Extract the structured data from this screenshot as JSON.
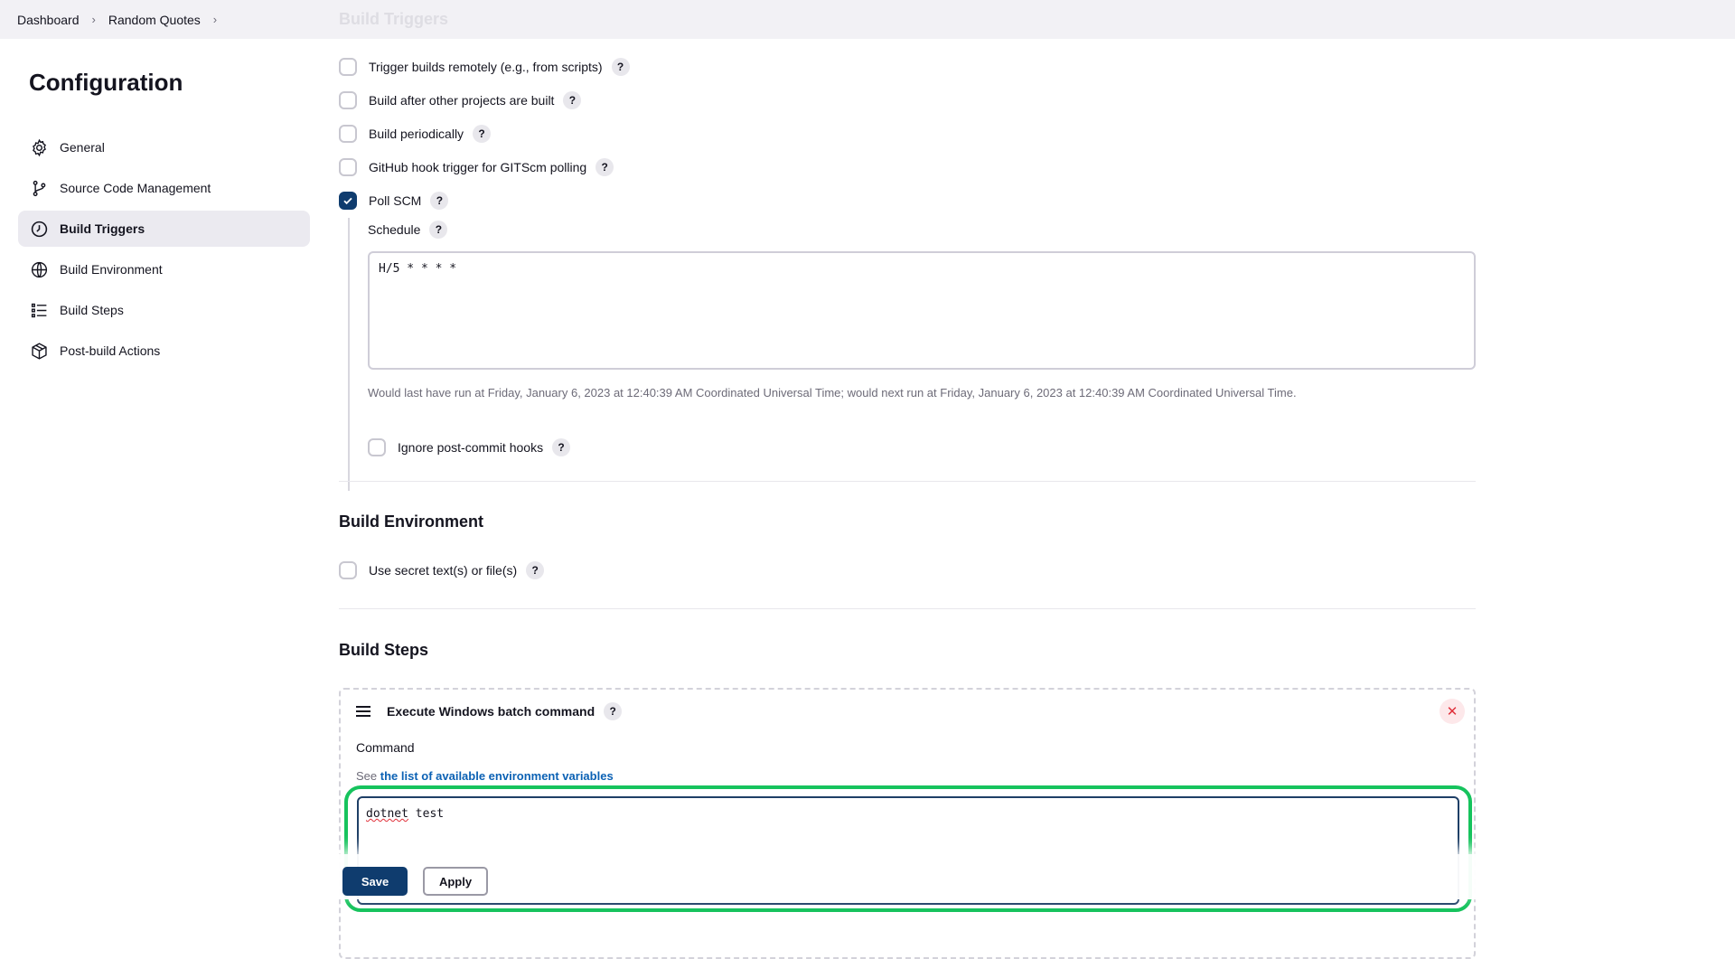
{
  "breadcrumb": {
    "items": [
      "Dashboard",
      "Random Quotes"
    ],
    "faded_section_title": "Build Triggers"
  },
  "sidebar": {
    "title": "Configuration",
    "items": [
      {
        "label": "General",
        "icon": "gear-icon"
      },
      {
        "label": "Source Code Management",
        "icon": "git-branch-icon"
      },
      {
        "label": "Build Triggers",
        "icon": "timer-icon",
        "active": true
      },
      {
        "label": "Build Environment",
        "icon": "globe-icon"
      },
      {
        "label": "Build Steps",
        "icon": "list-icon"
      },
      {
        "label": "Post-build Actions",
        "icon": "cube-icon"
      }
    ]
  },
  "triggers": {
    "remote": {
      "label": "Trigger builds remotely (e.g., from scripts)",
      "checked": false
    },
    "after_other": {
      "label": "Build after other projects are built",
      "checked": false
    },
    "periodically": {
      "label": "Build periodically",
      "checked": false
    },
    "github_hook": {
      "label": "GitHub hook trigger for GITScm polling",
      "checked": false
    },
    "poll_scm": {
      "label": "Poll SCM",
      "checked": true
    },
    "schedule_label": "Schedule",
    "schedule_value": "H/5 * * * *",
    "schedule_hint": "Would last have run at Friday, January 6, 2023 at 12:40:39 AM Coordinated Universal Time; would next run at Friday, January 6, 2023 at 12:40:39 AM Coordinated Universal Time.",
    "ignore_hooks": {
      "label": "Ignore post-commit hooks",
      "checked": false
    }
  },
  "build_environment": {
    "title": "Build Environment",
    "secret": {
      "label": "Use secret text(s) or file(s)",
      "checked": false
    }
  },
  "build_steps": {
    "title": "Build Steps",
    "step": {
      "title": "Execute Windows batch command",
      "command_label": "Command",
      "see_prefix": "See ",
      "see_link": "the list of available environment variables",
      "command_word1": "dotnet",
      "command_word2": " test"
    }
  },
  "help_glyph": "?",
  "close_glyph": "✕",
  "footer": {
    "save": "Save",
    "apply": "Apply"
  },
  "colors": {
    "accent": "#0f3c6e",
    "highlight": "#16c35d",
    "link": "#0b61b4",
    "danger": "#e0303a"
  }
}
